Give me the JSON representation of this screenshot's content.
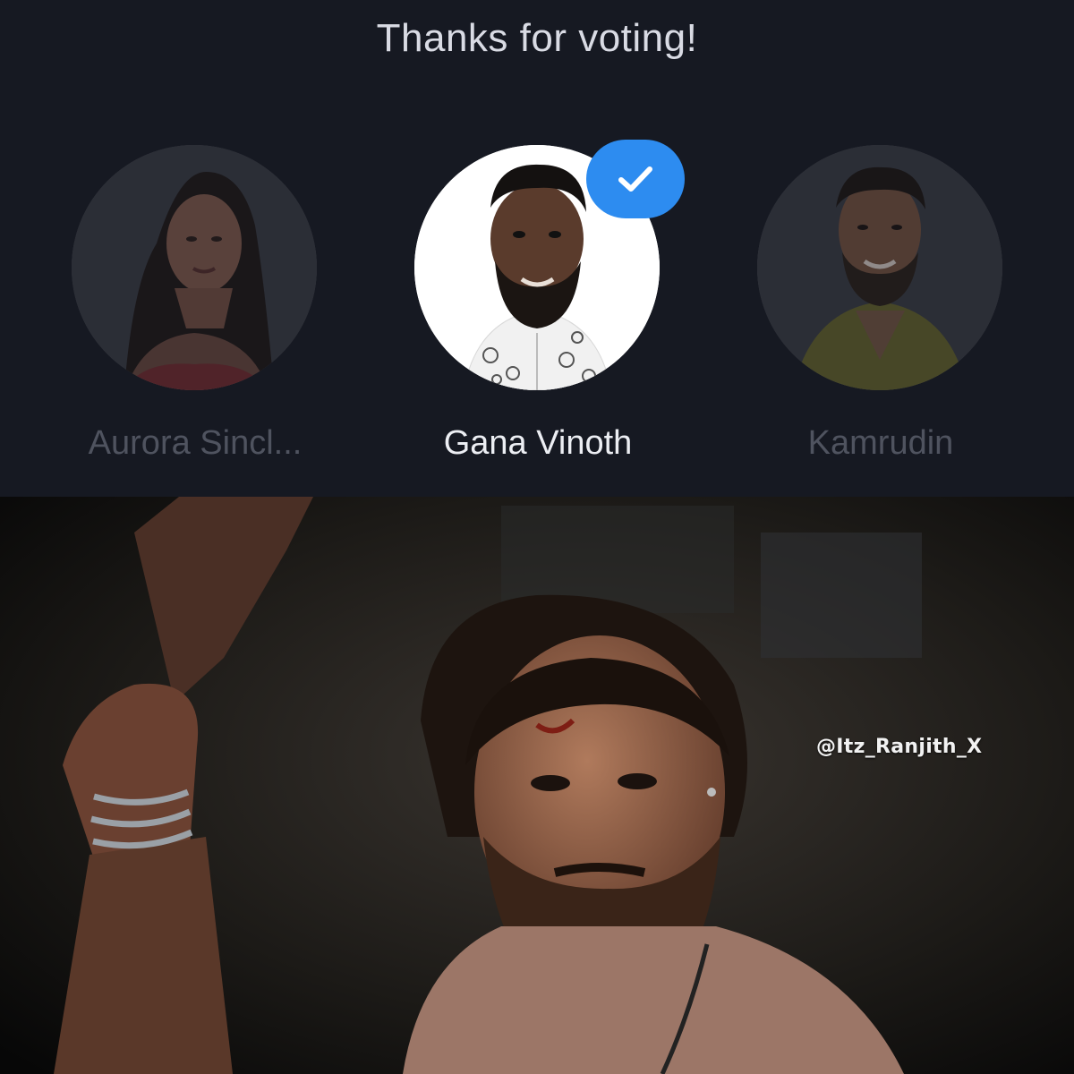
{
  "poll": {
    "title": "Thanks for voting!",
    "candidates": [
      {
        "name": "Aurora Sincl...",
        "selected": false
      },
      {
        "name": "Gana Vinoth",
        "selected": true
      },
      {
        "name": "Kamrudin",
        "selected": false
      }
    ],
    "selected_badge_icon": "checkmark-icon",
    "accent_color": "#2d8cf0"
  },
  "photo": {
    "watermark": "@Itz_Ranjith_X"
  }
}
